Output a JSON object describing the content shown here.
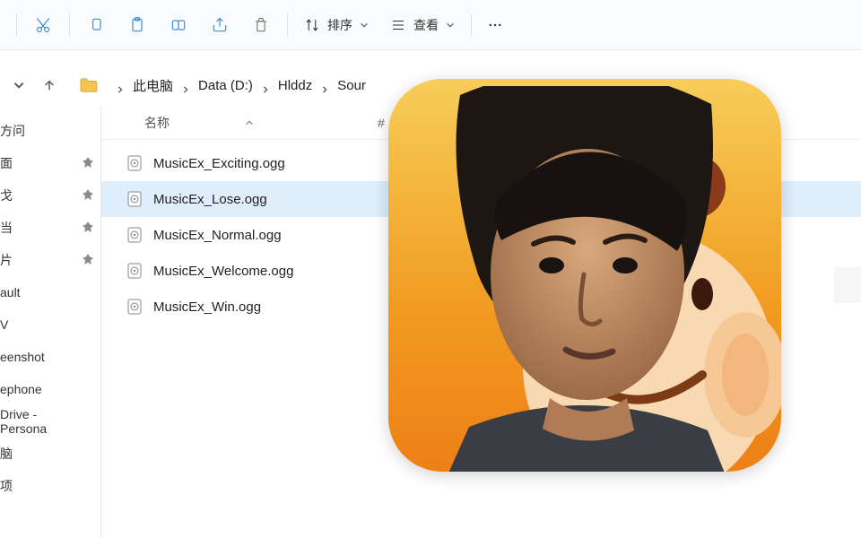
{
  "toolbar": {
    "sort_label": "排序",
    "view_label": "查看"
  },
  "breadcrumb": {
    "root": "此电脑",
    "drive": "Data (D:)",
    "folder1": "Hlddz",
    "folder2": "Sour"
  },
  "columns": {
    "name": "名称",
    "hash": "#"
  },
  "sidebar": {
    "items": [
      {
        "label": "方问",
        "pinned": false
      },
      {
        "label": "面",
        "pinned": true
      },
      {
        "label": "戈",
        "pinned": true
      },
      {
        "label": "当",
        "pinned": true
      },
      {
        "label": "片",
        "pinned": true
      },
      {
        "label": "ault",
        "pinned": false
      },
      {
        "label": "V",
        "pinned": false
      },
      {
        "label": "eenshot",
        "pinned": false
      },
      {
        "label": "ephone",
        "pinned": false
      },
      {
        "label": "Drive - Persona",
        "pinned": false
      },
      {
        "label": "脑",
        "pinned": false
      },
      {
        "label": "项",
        "pinned": false
      }
    ]
  },
  "files": [
    {
      "name": "MusicEx_Exciting.ogg",
      "selected": false
    },
    {
      "name": "MusicEx_Lose.ogg",
      "selected": true
    },
    {
      "name": "MusicEx_Normal.ogg",
      "selected": false
    },
    {
      "name": "MusicEx_Welcome.ogg",
      "selected": false
    },
    {
      "name": "MusicEx_Win.ogg",
      "selected": false
    }
  ]
}
